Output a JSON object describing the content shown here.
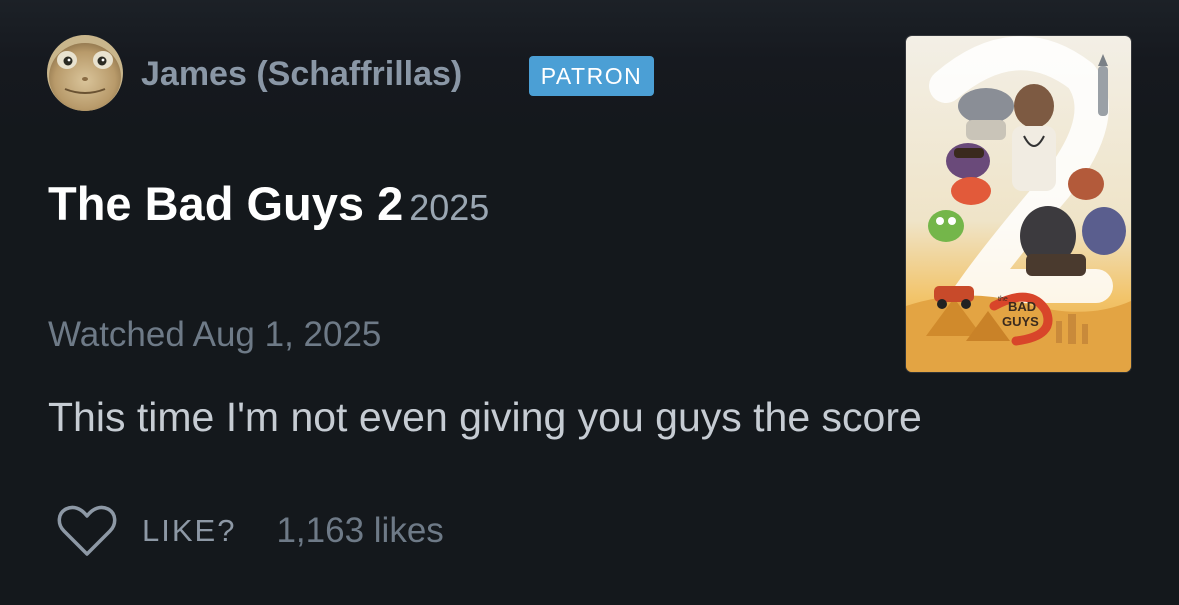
{
  "review": {
    "username": "James (Schaffrillas)",
    "badge": "PATRON",
    "film_title": "The Bad Guys 2",
    "film_year": "2025",
    "watched": "Watched Aug 1, 2025",
    "text": "This time I'm not even giving you guys the score",
    "like_label": "LIKE?",
    "likes_count": "1,163 likes"
  },
  "poster": {
    "logo_small": "the",
    "logo_line1": "BAD",
    "logo_line2": "GUYS"
  },
  "colors": {
    "background": "#14181c",
    "badge": "#4b9fd5",
    "title": "#ffffff",
    "muted": "#6e7a87",
    "body_text": "#c6ccd3"
  },
  "icons": {
    "heart": "heart-outline-icon"
  }
}
